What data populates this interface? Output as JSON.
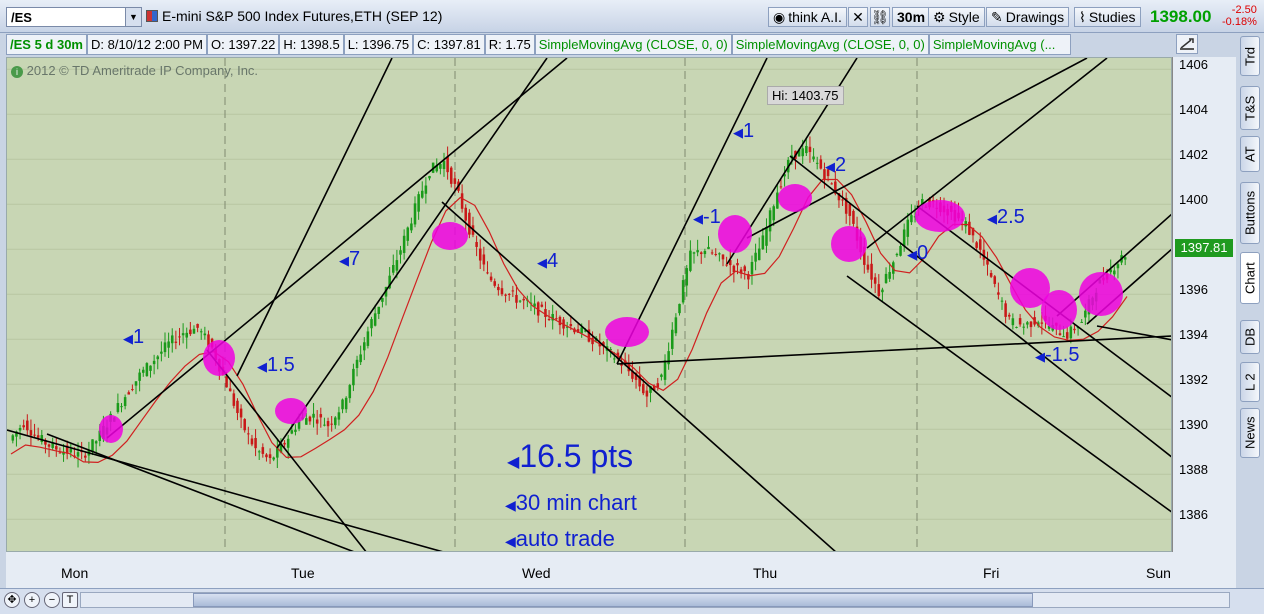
{
  "header": {
    "symbol": "/ES",
    "description": "E-mini S&P 500 Index Futures,ETH (SEP 12)",
    "buttons": [
      "think A.I.",
      "30m",
      "Style",
      "Drawings",
      "Studies"
    ],
    "last_price": "1398.00",
    "change": "-2.50",
    "change_pct": "-0.18%"
  },
  "infobar": {
    "symbol_period": "/ES 5 d 30m",
    "date": "D: 8/10/12 2:00 PM",
    "open": "O: 1397.22",
    "high": "H: 1398.5",
    "low": "L: 1396.75",
    "close": "C: 1397.81",
    "range": "R: 1.75",
    "studies": [
      "SimpleMovingAvg (CLOSE, 0, 0)",
      "SimpleMovingAvg (CLOSE, 0, 0)",
      "SimpleMovingAvg (..."
    ]
  },
  "chart": {
    "copyright": "2012 © TD Ameritrade IP Company, Inc.",
    "hi_label": "Hi: 1403.75",
    "current_price_label": "1397.81",
    "annotations": [
      "1",
      "1.5",
      "7",
      "4",
      "-1",
      "1",
      "2",
      "0",
      "2.5",
      "-1.5"
    ],
    "big_text": [
      "16.5 pts",
      "30 min chart",
      "auto trade"
    ],
    "y_ticks": [
      "1406",
      "1404",
      "1402",
      "1400",
      "1398",
      "1396",
      "1394",
      "1392",
      "1390",
      "1388",
      "1386"
    ],
    "x_labels": [
      "Mon",
      "Tue",
      "Wed",
      "Thu",
      "Fri",
      "Sun"
    ]
  },
  "chart_data": {
    "type": "candlestick",
    "title": "E-mini S&P 500 Index Futures,ETH (SEP 12)",
    "xlabel": "",
    "ylabel": "",
    "ylim": [
      1384.5,
      1406.5
    ],
    "categories": [
      "Mon",
      "Tue",
      "Wed",
      "Thu",
      "Fri",
      "Sun"
    ],
    "series": [
      {
        "name": "/ES 30m",
        "values": [
          1389.5,
          1390.3,
          1389.6,
          1389.2,
          1389.0,
          1388.8,
          1389.5,
          1390.5,
          1391.5,
          1392.4,
          1393.1,
          1393.8,
          1394.3,
          1394.5,
          1393.6,
          1392.0,
          1390.3,
          1389.1,
          1388.6,
          1389.4,
          1390.4,
          1390.6,
          1390.2,
          1391.1,
          1393.0,
          1394.8,
          1396.3,
          1398.0,
          1399.8,
          1401.5,
          1401.9,
          1400.4,
          1398.4,
          1396.8,
          1396.2,
          1395.8,
          1395.5,
          1395.1,
          1394.8,
          1394.5,
          1394.1,
          1393.6,
          1393.1,
          1392.4,
          1391.5,
          1392.3,
          1395.1,
          1397.7,
          1398.0,
          1397.6,
          1397.2,
          1396.9,
          1398.4,
          1400.6,
          1402.2,
          1402.4,
          1401.6,
          1400.6,
          1399.5,
          1397.5,
          1396.1,
          1397.5,
          1399.1,
          1400.1,
          1400.0,
          1399.6,
          1399.1,
          1397.9,
          1396.3,
          1394.8,
          1394.6,
          1394.9,
          1394.5,
          1394.2,
          1394.8,
          1396.3,
          1397.1,
          1397.8
        ]
      }
    ],
    "grid": true,
    "legend": "none"
  },
  "sidetabs": [
    "Trd",
    "T&S",
    "AT",
    "Buttons",
    "Chart",
    "DB",
    "L 2",
    "News"
  ]
}
